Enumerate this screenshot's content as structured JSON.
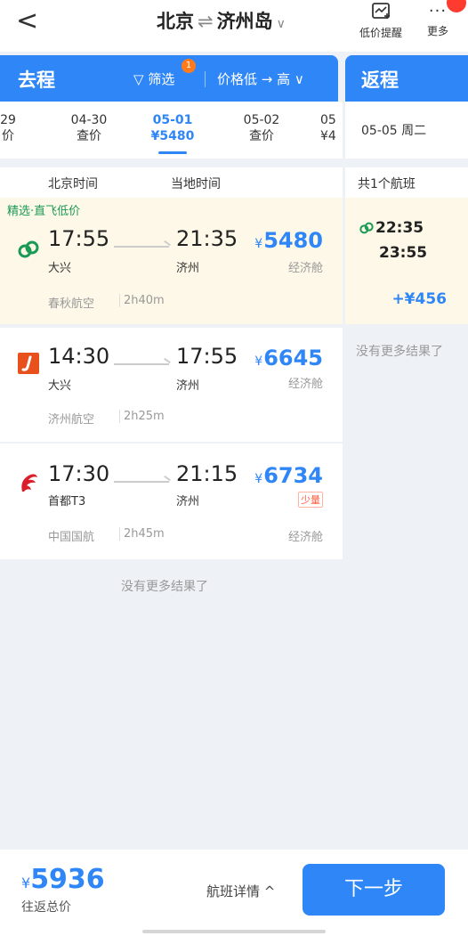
{
  "topbar": {
    "back_glyph": "<",
    "from": "北京",
    "to": "济州岛",
    "sep_glyph": "⇌",
    "chevron_glyph": "∨",
    "alert_label": "低价提醒",
    "more_label": "更多"
  },
  "outbound": {
    "title": "去程",
    "filter_label": "筛选",
    "filter_count": "1",
    "sort_label": "价格低 → 高 ∨",
    "dates": [
      {
        "date": "29",
        "price": "价"
      },
      {
        "date": "04-30",
        "price": "查价"
      },
      {
        "date": "05-01",
        "price": "¥5480"
      },
      {
        "date": "05-02",
        "price": "查价"
      },
      {
        "date": "05",
        "price": "¥4"
      }
    ],
    "col_beijing": "北京时间",
    "col_local": "当地时间",
    "flights": [
      {
        "tag": "精选·直飞低价",
        "dep_time": "17:55",
        "dep_airport": "大兴",
        "arr_time": "21:35",
        "arr_airport": "济州",
        "yen": "¥",
        "price": "5480",
        "cabin": "经济舱",
        "airline": "春秋航空",
        "duration": "2h40m"
      },
      {
        "dep_time": "14:30",
        "dep_airport": "大兴",
        "arr_time": "17:55",
        "arr_airport": "济州",
        "yen": "¥",
        "price": "6645",
        "cabin": "经济舱",
        "airline": "济州航空",
        "duration": "2h25m"
      },
      {
        "dep_time": "17:30",
        "dep_airport": "首都T3",
        "arr_time": "21:15",
        "arr_airport": "济州",
        "yen": "¥",
        "price": "6734",
        "scarce": "少量",
        "cabin": "经济舱",
        "airline": "中国国航",
        "duration": "2h45m"
      }
    ],
    "no_more": "没有更多结果了"
  },
  "return": {
    "title": "返程",
    "date": "05-05 周二",
    "count": "共1个航班",
    "flight": {
      "dep_time": "22:35",
      "arr_time": "23:55",
      "price_diff": "+¥456"
    },
    "no_more": "没有更多结果了"
  },
  "footer": {
    "yen": "¥",
    "total": "5936",
    "total_label": "往返总价",
    "detail_label": "航班详情 ^",
    "next_label": "下一步"
  },
  "colors": {
    "accent": "#2f86f6",
    "highlight_bg": "#fdf8e7",
    "green": "#1a9a55"
  }
}
